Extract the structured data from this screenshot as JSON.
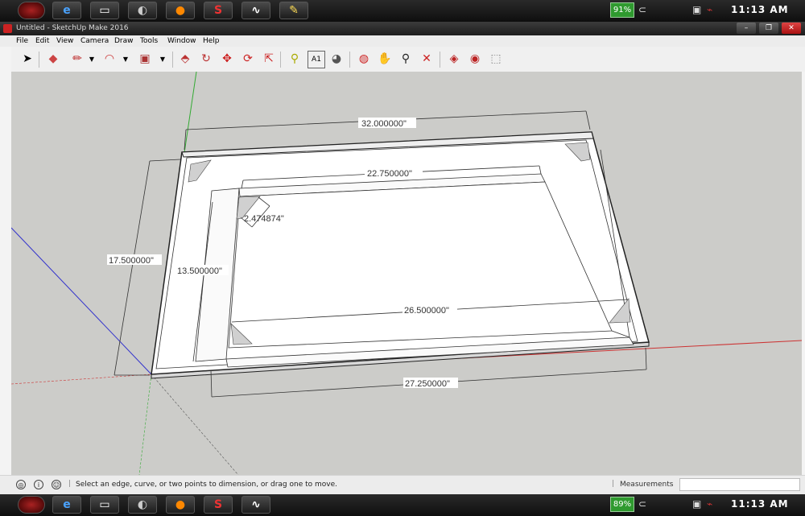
{
  "taskbar_top": {
    "battery": "91%",
    "time": "11:13 AM"
  },
  "taskbar_bottom": {
    "battery": "89%",
    "time": "11:13 AM"
  },
  "window": {
    "title": "Untitled - SketchUp Make 2016"
  },
  "menu": [
    "File",
    "Edit",
    "View",
    "Camera",
    "Draw",
    "Tools",
    "Window",
    "Help"
  ],
  "toolbar_icons": [
    "select-icon",
    "eraser-icon",
    "pencil-icon",
    "arc-icon",
    "rectangle-icon",
    "push-pull-icon",
    "follow-me-icon",
    "move-icon",
    "rotate-icon",
    "scale-icon",
    "tape-measure-icon",
    "text-icon",
    "paint-bucket-icon",
    "orbit-icon",
    "pan-icon",
    "zoom-icon",
    "zoom-extents-icon",
    "3d-warehouse-icon",
    "extension-warehouse-icon",
    "layout-icon"
  ],
  "dimensions": {
    "outer_width": "32.000000\"",
    "outer_depth": "17.500000\"",
    "inner_slot": "22.750000\"",
    "corner_brace": "2.474874\"",
    "inner_depth": "13.500000\"",
    "inner_width": "26.500000\"",
    "base_width": "27.250000\""
  },
  "status": {
    "text": "Select an edge, curve, or two points to dimension, or drag one to move.",
    "measurements_label": "Measurements"
  }
}
